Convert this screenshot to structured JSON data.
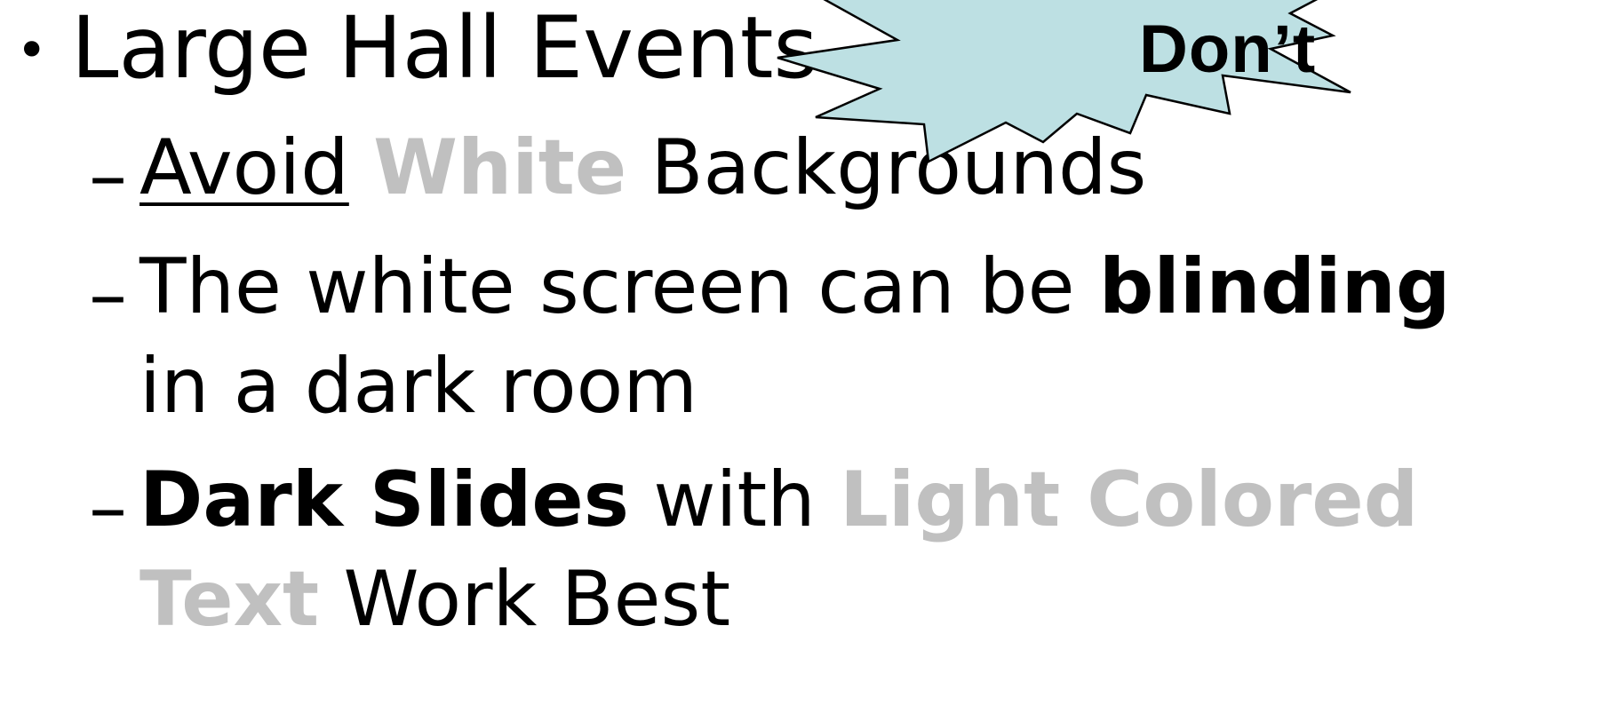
{
  "slide": {
    "heading": "Large Hall Events",
    "bullets": [
      {
        "parts": [
          "Avoid",
          " ",
          "White",
          " Backgrounds"
        ]
      },
      {
        "parts": [
          "The white screen can be ",
          "blinding",
          "in a dark room"
        ]
      },
      {
        "parts": [
          "Dark Slides",
          " with ",
          "Light Colored",
          "Text",
          " Work Best"
        ]
      }
    ],
    "callout": "Don’t"
  },
  "colors": {
    "text": "#000000",
    "light_text": "#c0c0c0",
    "callout_fill": "#bde0e3",
    "callout_stroke": "#000000"
  }
}
